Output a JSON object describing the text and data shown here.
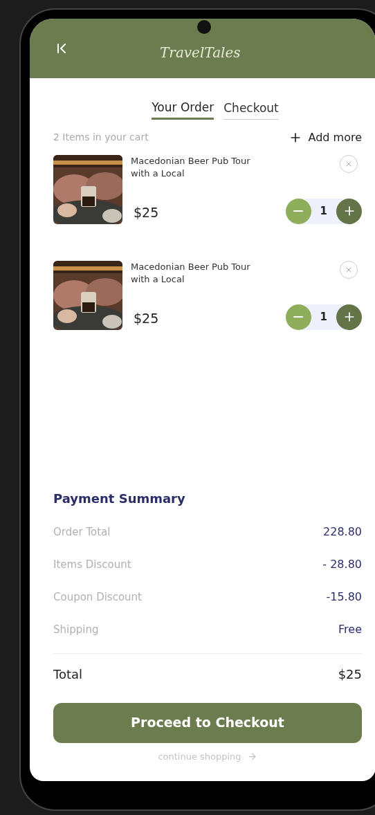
{
  "header": {
    "logo": "TravelTales"
  },
  "tabs": [
    {
      "label": "Your Order",
      "selected": true
    },
    {
      "label": "Checkout",
      "selected": false
    }
  ],
  "cart": {
    "count_label": "2 Items in your cart",
    "add_more": "Add more"
  },
  "items": [
    {
      "title": "Macedonian Beer Pub Tour with a Local",
      "price": "$25",
      "quantity": "1"
    },
    {
      "title": "Macedonian Beer Pub Tour with a Local",
      "price": "$25",
      "quantity": "1"
    }
  ],
  "payment_summary": {
    "title": "Payment Summary",
    "rows": [
      {
        "label": "Order Total",
        "value": "228.80"
      },
      {
        "label": "Items Discount",
        "value": "- 28.80"
      },
      {
        "label": "Coupon Discount",
        "value": "-15.80"
      },
      {
        "label": "Shipping",
        "value": "Free"
      }
    ],
    "total": {
      "label": "Total",
      "value": "$25"
    }
  },
  "primary_button": "Proceed to Checkout",
  "secondary_link": "continue shopping"
}
